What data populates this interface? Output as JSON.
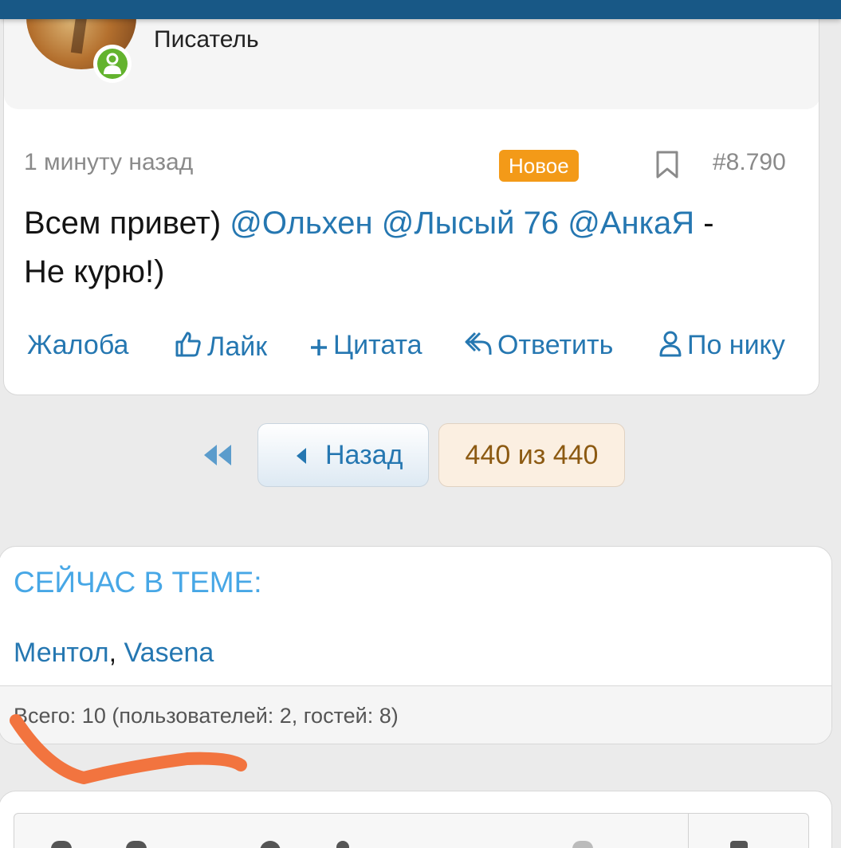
{
  "post": {
    "rank": "Писатель",
    "time": "1 минуту назад",
    "badge": "Новое",
    "number": "#8.790",
    "message": {
      "greeting": "Всем привет)",
      "mentions": [
        "@Ольхен",
        "@Лысый 76",
        "@АнкаЯ"
      ],
      "dash": "-",
      "rest": "Не курю!)"
    },
    "actions": {
      "report": "Жалоба",
      "like": "Лайк",
      "quote": "Цитата",
      "reply": "Ответить",
      "by_nick": "По нику"
    }
  },
  "pagination": {
    "back_label": "Назад",
    "page_label": "440 из 440"
  },
  "online_now": {
    "title": "СЕЙЧАС В ТЕМЕ:",
    "users": [
      "Ментол",
      "Vasena"
    ],
    "separator": ",",
    "total": "Всего: 10 (пользователей: 2, гостей: 8)"
  },
  "colors": {
    "topbar": "#185886",
    "link": "#2577b1",
    "badge_new": "#f39a18",
    "online_dot": "#63b32e",
    "heading": "#47a7e6",
    "annotation_stroke": "#f2743f"
  },
  "icons": [
    "user-icon",
    "bookmark-icon",
    "thumbs-up-icon",
    "plus-icon",
    "reply-icon",
    "person-icon",
    "double-chevron-left-icon",
    "chevron-left-icon"
  ]
}
